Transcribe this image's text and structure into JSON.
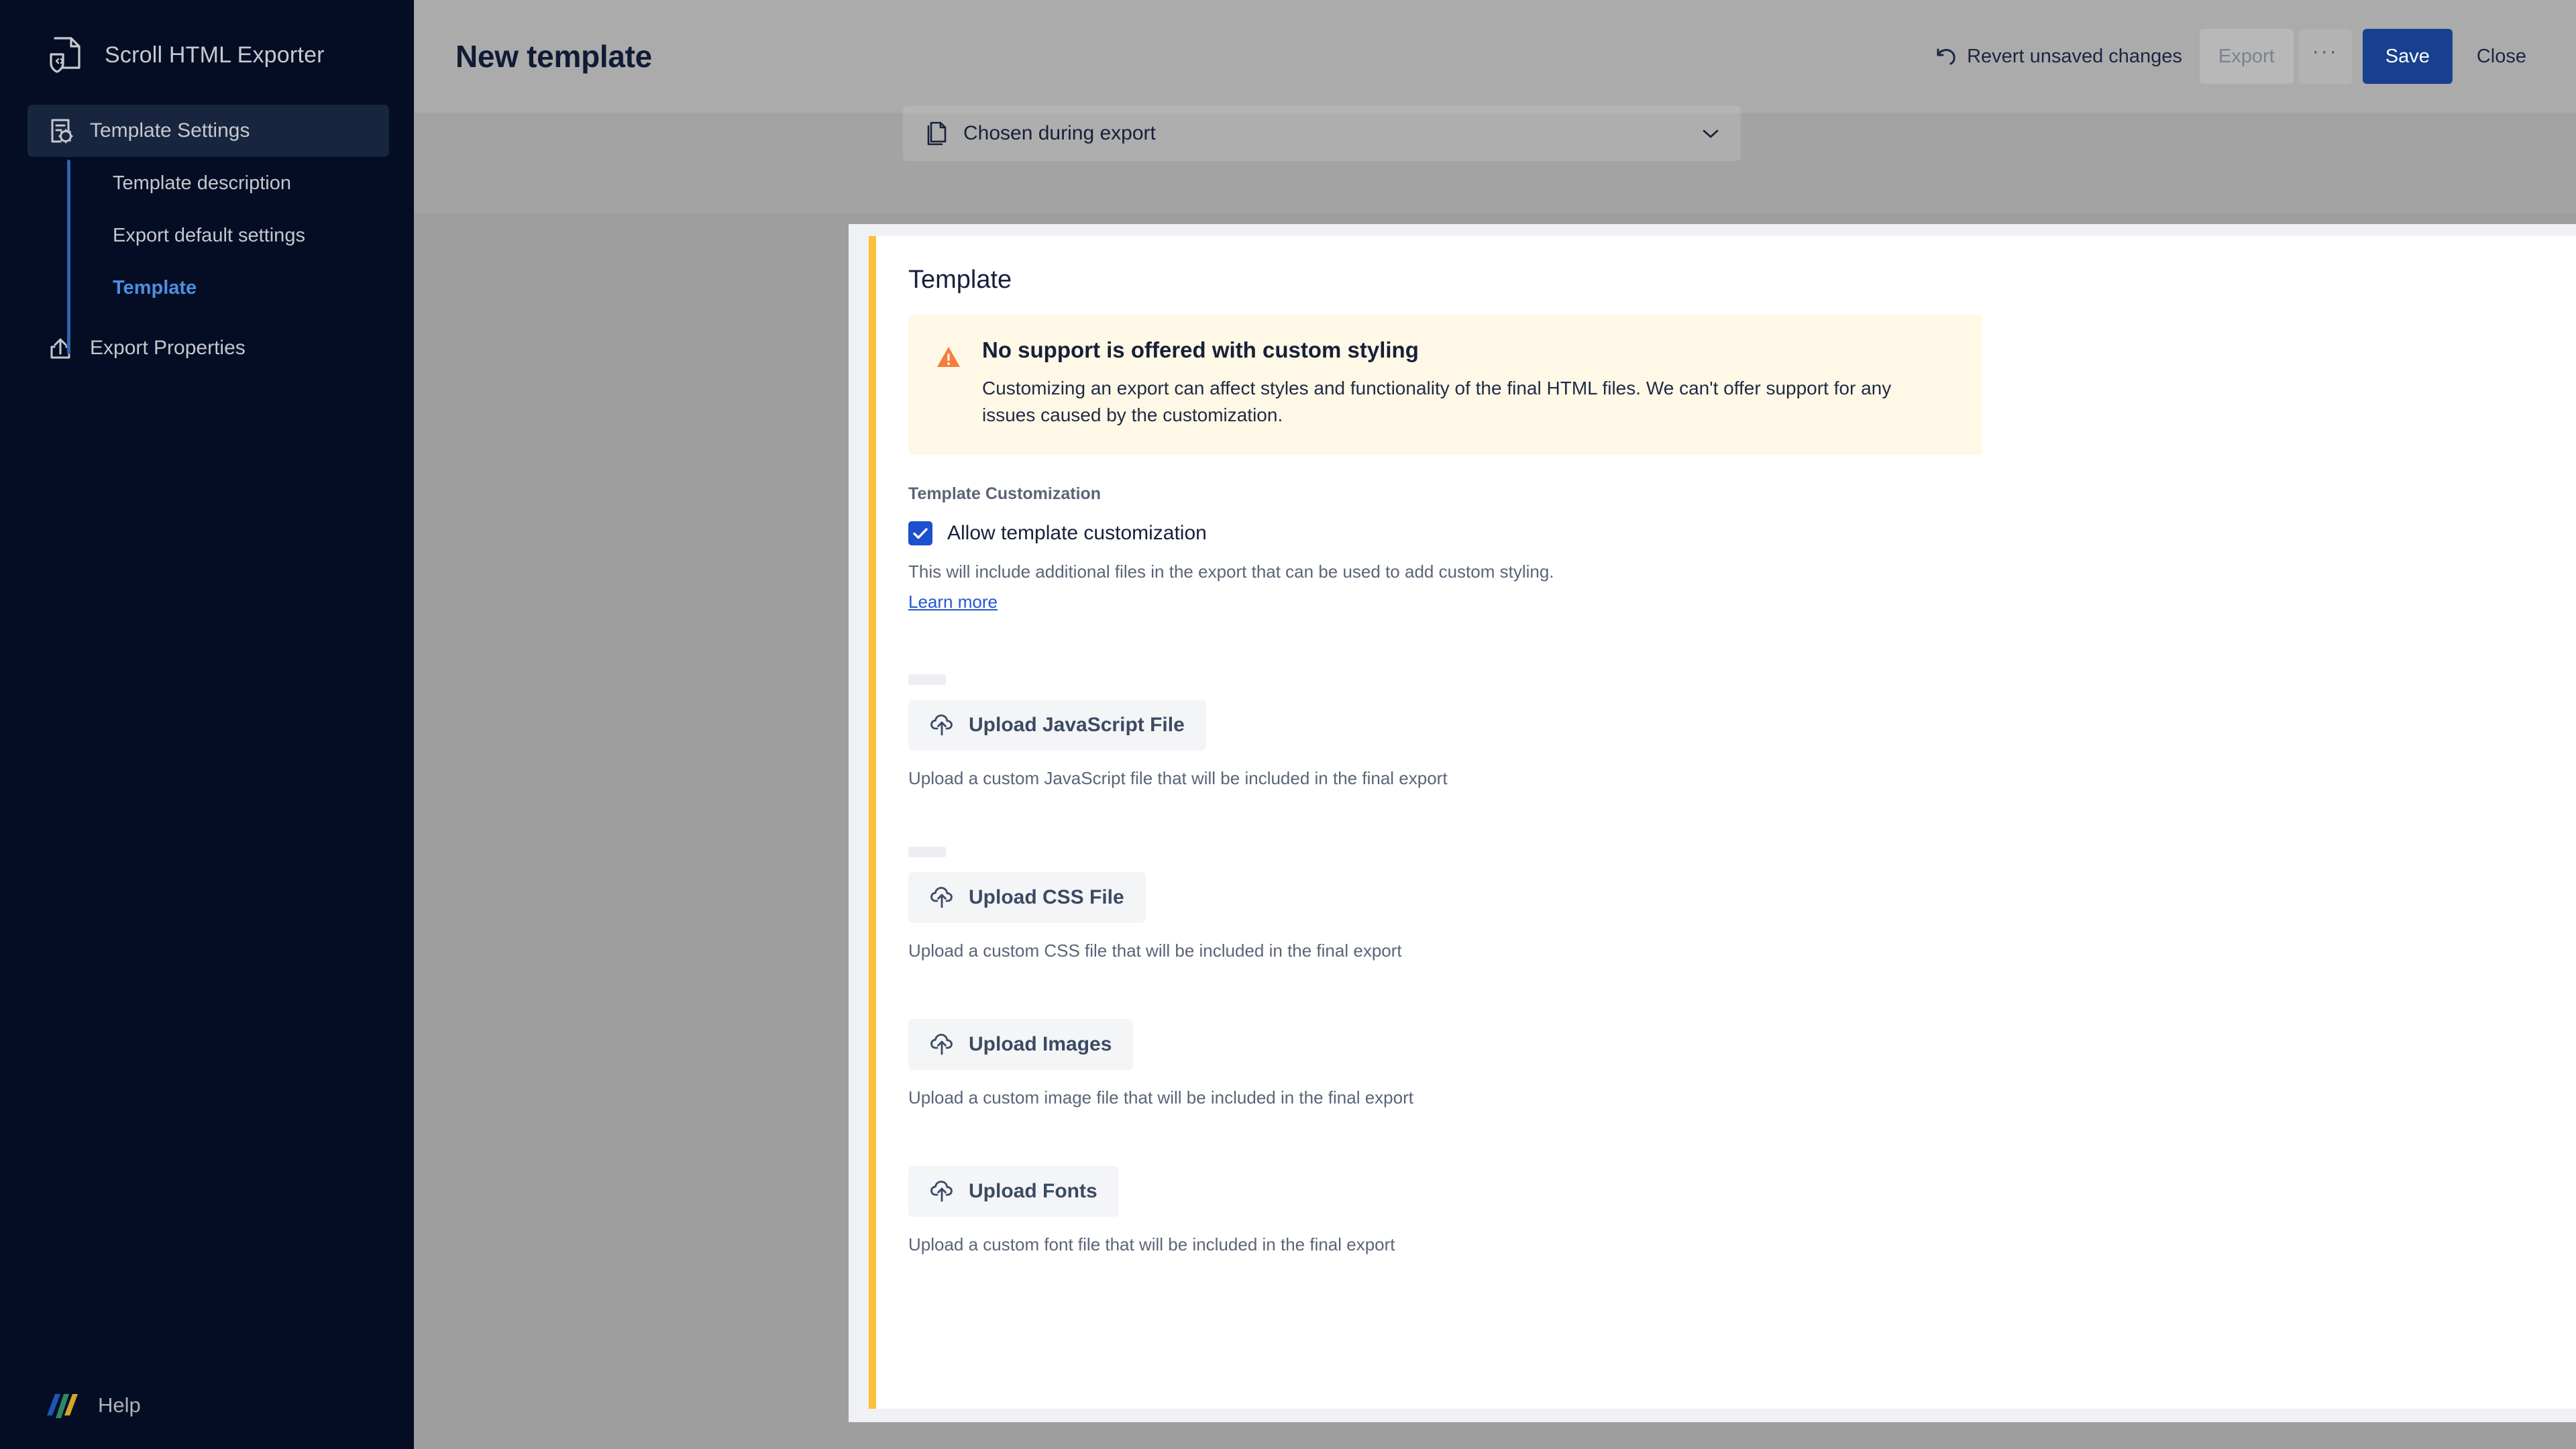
{
  "sidebar": {
    "brand": {
      "label": "Scroll HTML Exporter",
      "icon": "html-document-shield-icon"
    },
    "primary_top": {
      "label": "Template Settings",
      "icon": "document-gear-icon",
      "active": true
    },
    "sub_items": [
      {
        "label": "Template description",
        "current": false
      },
      {
        "label": "Export default settings",
        "current": false
      },
      {
        "label": "Template",
        "current": true
      }
    ],
    "primary_bottom": {
      "label": "Export Properties",
      "icon": "export-share-icon"
    },
    "help": {
      "label": "Help",
      "icon": "k15t-logo-icon"
    }
  },
  "header": {
    "title": "New template",
    "revert_label": "Revert unsaved changes",
    "revert_icon": "undo-arrow-icon",
    "export_label": "Export",
    "more_label": "···",
    "save_label": "Save",
    "close_label": "Close"
  },
  "select": {
    "icon": "document-copy-icon",
    "value": "Chosen during export",
    "chevron_icon": "chevron-down-icon"
  },
  "card": {
    "title": "Template",
    "warning": {
      "icon": "warning-triangle-icon",
      "title": "No support is offered with custom styling",
      "body": "Customizing an export can affect styles and functionality of the final HTML files. We can't offer support for any issues caused by the customization."
    },
    "section_label": "Template Customization",
    "checkbox": {
      "label": "Allow template customization",
      "checked": true,
      "icon": "checkmark-icon"
    },
    "help_text": "This will include additional files in the export that can be used to add custom styling.",
    "learn_more": "Learn more",
    "uploads": [
      {
        "button_label": "Upload JavaScript File",
        "icon": "cloud-upload-icon",
        "description": "Upload a custom JavaScript file that will be included in the final export"
      },
      {
        "button_label": "Upload CSS File",
        "icon": "cloud-upload-icon",
        "description": "Upload a custom CSS file that will be included in the final export"
      },
      {
        "button_label": "Upload Images",
        "icon": "cloud-upload-icon",
        "description": "Upload a custom image file that will be included in the final export"
      },
      {
        "button_label": "Upload Fonts",
        "icon": "cloud-upload-icon",
        "description": "Upload a custom font file that will be included in the final export"
      }
    ]
  },
  "colors": {
    "sidebar_bg": "#050D25",
    "sidebar_active": "#18253F",
    "rail": "#2F63AE",
    "current_link": "#4C8FE0",
    "accent_bar": "#FAC037",
    "warning_bg": "#FFF8E6",
    "warning_icon": "#F87C3A",
    "save_button": "#17418F",
    "checkbox": "#1B50CE",
    "link": "#2157D4",
    "panel_bg": "#F0F1F5"
  }
}
